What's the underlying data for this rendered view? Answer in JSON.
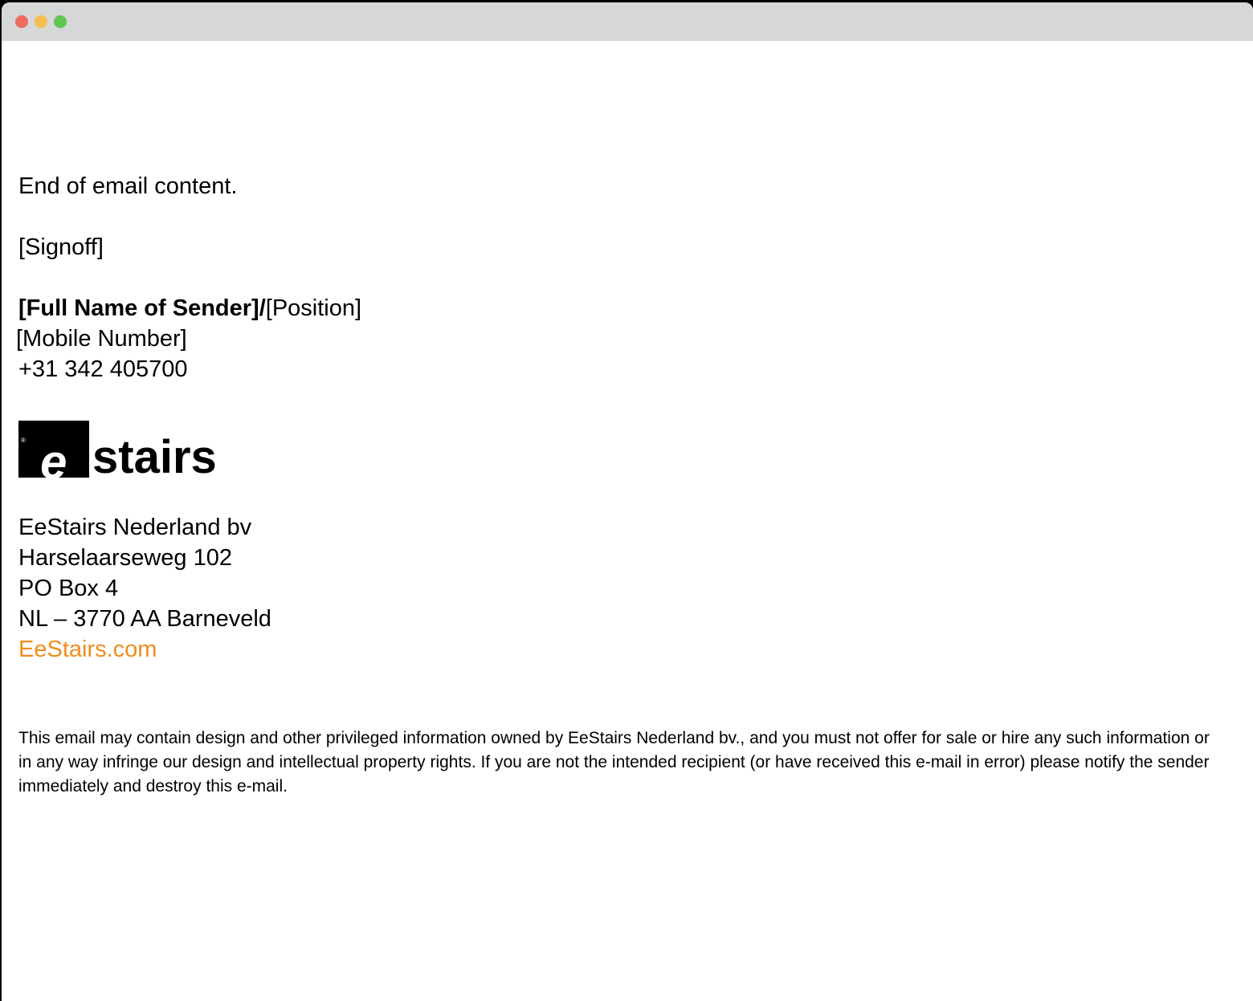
{
  "window": {
    "traffic_lights": [
      {
        "name": "close",
        "color": "#ed6b5f"
      },
      {
        "name": "minimize",
        "color": "#f5bf4f"
      },
      {
        "name": "maximize",
        "color": "#61c554"
      }
    ]
  },
  "email": {
    "body_end": "End of email content.",
    "signoff": "[Signoff]",
    "sender_name": "[Full Name of Sender]/",
    "position": "[Position]",
    "mobile": "[Mobile Number]",
    "phone": "+31 342 405700"
  },
  "logo": {
    "reg_mark": "®",
    "e1": "e",
    "e2": "e",
    "word": "stairs"
  },
  "address": {
    "company": "EeStairs Nederland bv",
    "street": "Harselaarseweg 102",
    "po_box": "PO Box 4",
    "city": "NL – 3770 AA Barneveld",
    "website": "EeStairs.com",
    "link_color": "#f28c1c"
  },
  "disclaimer": "This email may contain design and other privileged information owned by EeStairs Nederland bv., and you must not offer for sale or hire any such information or in any way infringe our design and intellectual property rights. If you are not the intended recipient (or have received this e-mail in error) please notify the sender immediately and destroy this e-mail."
}
